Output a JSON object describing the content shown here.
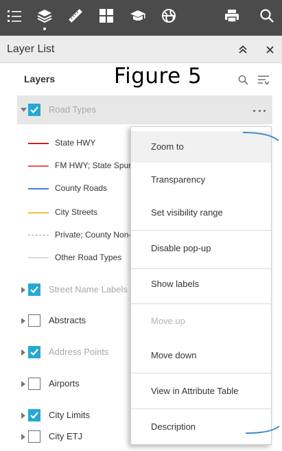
{
  "panel": {
    "title": "Layer List"
  },
  "layers_section": {
    "label": "Layers",
    "figure_label": "Figure 5"
  },
  "toolbar": {
    "icons": [
      "layer-list-icon",
      "layers-stack-icon",
      "measure-ruler-icon",
      "grid-icon",
      "graduation-cap-icon",
      "basemap-gallery-icon",
      "print-icon",
      "search-icon"
    ]
  },
  "layers": [
    {
      "label": "Road Types",
      "checked": true,
      "expanded": true,
      "dimmed": true,
      "selected": true
    },
    {
      "label": "Street Name Labels",
      "checked": true,
      "expanded": false,
      "dimmed": true
    },
    {
      "label": "Abstracts",
      "checked": false,
      "expanded": false,
      "dimmed": false
    },
    {
      "label": "Address Points",
      "checked": true,
      "expanded": false,
      "dimmed": true
    },
    {
      "label": "Airports",
      "checked": false,
      "expanded": false,
      "dimmed": false
    },
    {
      "label": "City Limits",
      "checked": true,
      "expanded": false,
      "dimmed": false
    },
    {
      "label": "City ETJ",
      "checked": false,
      "expanded": false,
      "dimmed": false
    }
  ],
  "legend": [
    {
      "label": "State HWY",
      "color": "#cc1f1f",
      "style": "solid"
    },
    {
      "label": "FM HWY; State Spur",
      "color": "#e8555b",
      "style": "solid"
    },
    {
      "label": "County Roads",
      "color": "#3d82d6",
      "style": "solid"
    },
    {
      "label": "City Streets",
      "color": "#f3be45",
      "style": "solid"
    },
    {
      "label": "Private; County Non-Maintained",
      "color": "#9a9a9a",
      "style": "dashed"
    },
    {
      "label": "Other Road Types",
      "color": "#bdbdbd",
      "style": "solid"
    }
  ],
  "context_menu": {
    "items": [
      {
        "label": "Zoom to",
        "disabled": false,
        "hover": true
      },
      {
        "label": "Transparency",
        "disabled": false
      },
      {
        "label": "Set visibility range",
        "disabled": false
      },
      {
        "label": "Disable pop-up",
        "disabled": false
      },
      {
        "label": "Show labels",
        "disabled": false
      },
      {
        "label": "Move up",
        "disabled": true
      },
      {
        "label": "Move down",
        "disabled": false
      },
      {
        "label": "View in Attribute Table",
        "disabled": false
      },
      {
        "label": "Description",
        "disabled": false
      }
    ]
  },
  "colors": {
    "toolbar_bg": "#4b4b4b",
    "header_bg": "#ececec",
    "checkbox_checked": "#24a9d4",
    "annotation_line": "#3f8dd0"
  }
}
